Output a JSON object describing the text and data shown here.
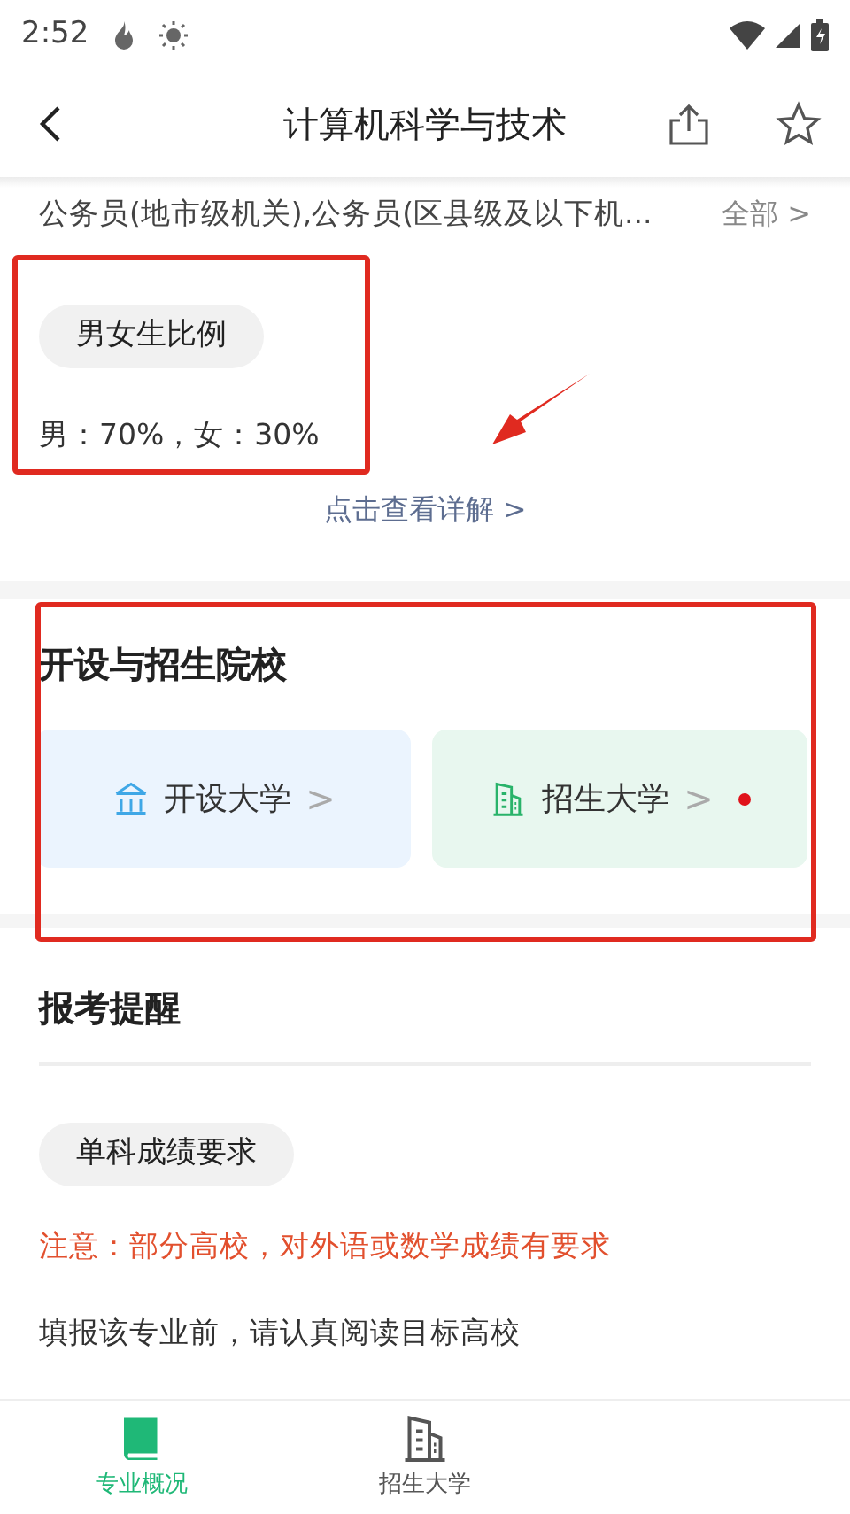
{
  "status_bar": {
    "time": "2:52"
  },
  "header": {
    "title": "计算机科学与技术"
  },
  "careers": {
    "text": "公务员(地市级机关),公务员(区县级及以下机...",
    "more": "全部 >"
  },
  "gender": {
    "tag": "男女生比例",
    "text": "男：70%，女：30%",
    "link": "点击查看详解 >"
  },
  "schools": {
    "title": "开设与招生院校",
    "cards": [
      {
        "kind": "open",
        "label": "开设大学",
        "chevron": ">",
        "dot": false
      },
      {
        "kind": "enroll",
        "label": "招生大学",
        "chevron": ">",
        "dot": true
      }
    ]
  },
  "reminder": {
    "title": "报考提醒",
    "tag": "单科成绩要求",
    "note": "注意：部分高校，对外语或数学成绩有要求",
    "text": "填报该专业前，请认真阅读目标高校"
  },
  "bottom_nav": [
    {
      "kind": "book",
      "label": "专业概况",
      "selected": true
    },
    {
      "kind": "building",
      "label": "招生大学",
      "selected": false
    }
  ]
}
